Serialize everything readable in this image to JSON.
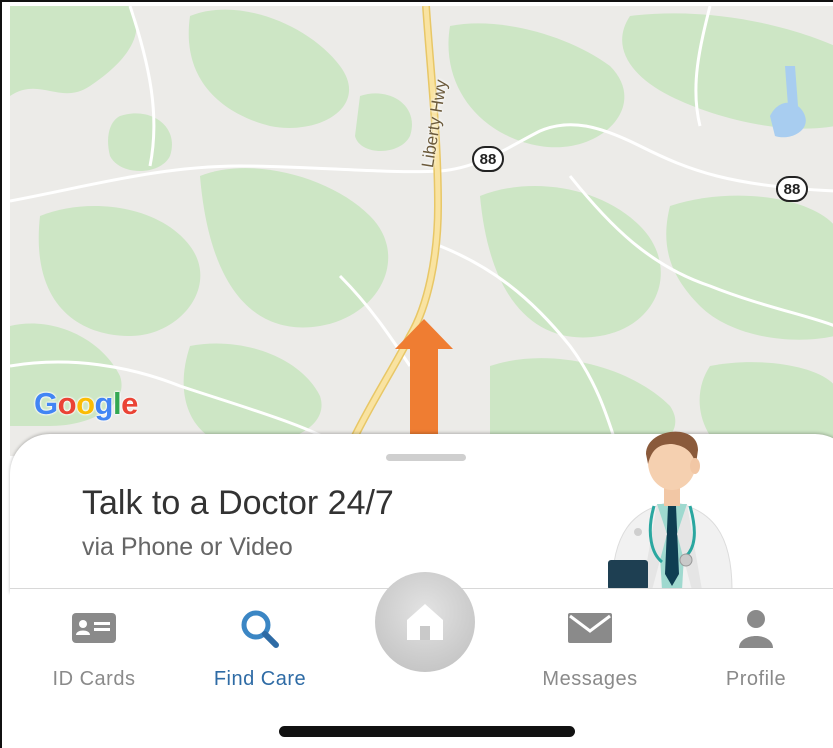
{
  "map": {
    "road_label": "Liberty Hwy",
    "route_shields": [
      "88",
      "88"
    ],
    "provider_logo": "Google"
  },
  "sheet": {
    "title": "Talk to a Doctor 24/7",
    "subtitle": "via Phone or Video",
    "illustration": "doctor-illustration"
  },
  "tabs": [
    {
      "label": "ID Cards",
      "icon": "id-card-icon",
      "active": false
    },
    {
      "label": "Find Care",
      "icon": "search-icon",
      "active": true
    },
    {
      "label": "",
      "icon": "home-icon",
      "active": false
    },
    {
      "label": "Messages",
      "icon": "envelope-icon",
      "active": false
    },
    {
      "label": "Profile",
      "icon": "person-icon",
      "active": false
    }
  ],
  "colors": {
    "accent": "#2e6ba5",
    "arrow": "#ef7d32",
    "map_green": "#cfe8c9",
    "road_yellow": "#f7dc8c"
  }
}
